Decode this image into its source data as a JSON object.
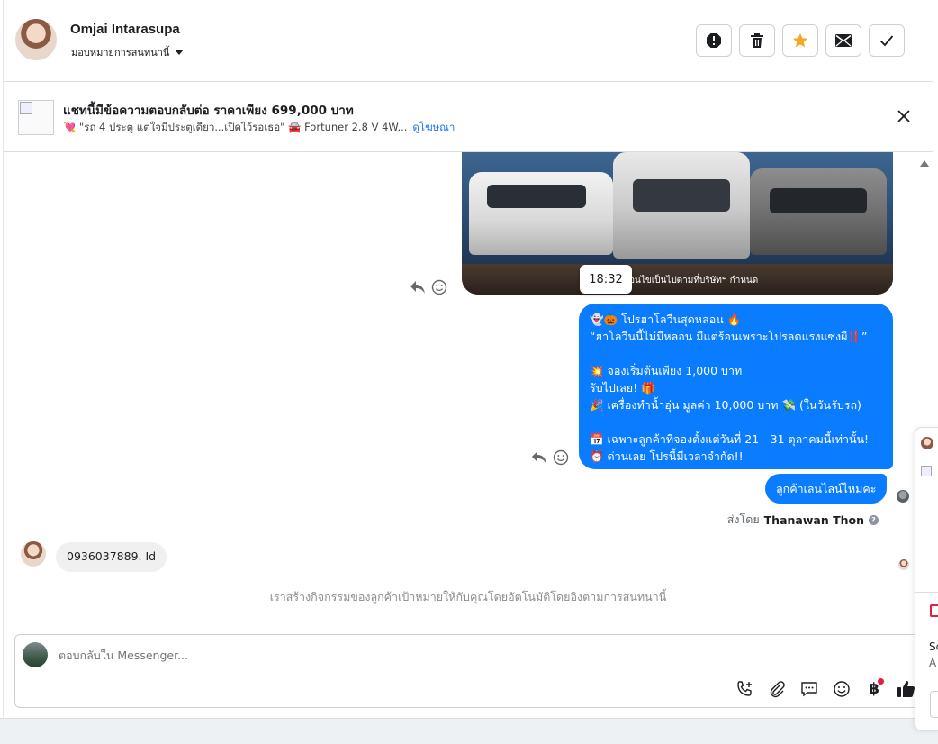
{
  "header": {
    "name": "Omjai Intarasupa",
    "assign_label": "มอบหมายการสนทนานี้",
    "actions": [
      "spam-icon",
      "trash-icon",
      "star-icon",
      "mail-icon",
      "check-icon"
    ],
    "star_color": "#f5a623"
  },
  "ad": {
    "title": "แชทนี้มีข้อความตอบกลับต่อ ราคาเพียง 699,000 บาท",
    "snippet": "💘 \"รถ 4 ประตู แต่ใจมีประตูเดียว...เปิดไว้รอเธอ\" 🚘 Fortuner 2.8 V 4W...",
    "link": "ดูโฆษณา"
  },
  "thread": {
    "image_caption": "อนไขเป็นไปตามที่บริษัทฯ กำหนด",
    "timestamp": "18:32",
    "promo_text": "👻🎃 โปรฮาโลวีนสุดหลอน 🔥\n“ฮาโลวีนนี้ไม่มีหลอน มีแต่ร้อนเพราะโปรลดแรงแซงผี‼️”\n\n💥 จองเริ่มต้นเพียง 1,000 บาท\nรับไปเลย! 🎁\n🎉 เครื่องทำน้ำอุ่น มูลค่า 10,000 บาท 💸 (ในวันรับรถ)\n\n📅 เฉพาะลูกค้าที่จองตั้งแต่วันที่ 21 - 31 ตุลาคมนี้เท่านั้น!\n⏰ ด่วนเลย โปรนี้มีเวลาจำกัด!!",
    "short_reply": "ลูกค้าเลนไลน์ไหมคะ",
    "sent_by_prefix": "ส่งโดย",
    "sent_by_name": "Thanawan Thon",
    "incoming_text": "0936037889. Id",
    "system_note": "เราสร้างกิจกรรมของลูกค้าเป้าหมายให้กับคุณโดยอัตโนมัติโดยอิงตามการสนทนานี้"
  },
  "composer": {
    "placeholder": "ตอบกลับใน Messenger...",
    "icons": [
      "call-add-icon",
      "attachment-icon",
      "saved-reply-icon",
      "emoji-icon",
      "baht-icon",
      "like-icon"
    ],
    "accent": "#0a7cff"
  },
  "side_panel": {
    "line1": "Sc",
    "line2": "A"
  }
}
